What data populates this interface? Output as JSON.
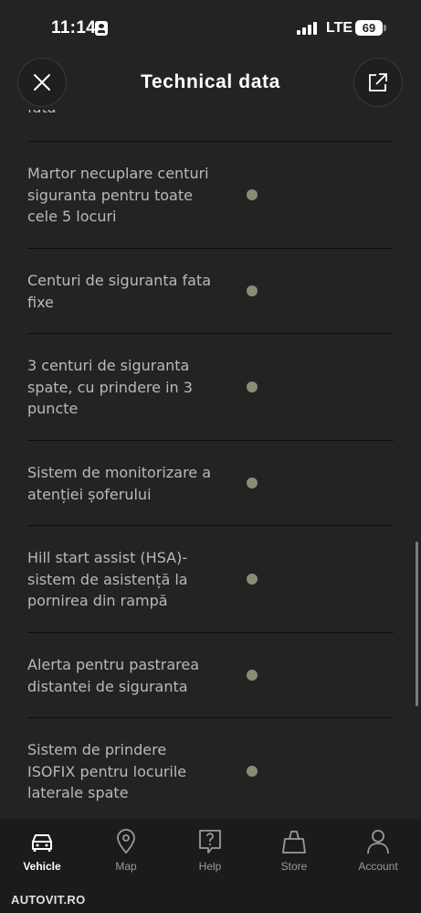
{
  "status_bar": {
    "time": "11:14",
    "network": "LTE",
    "battery": "69"
  },
  "header": {
    "title": "Technical data"
  },
  "features": [
    {
      "label": "fata",
      "available": true
    },
    {
      "label": "Martor necuplare centuri siguranta pentru toate cele 5 locuri",
      "available": true
    },
    {
      "label": "Centuri de siguranta fata fixe",
      "available": true
    },
    {
      "label": "3 centuri de siguranta spate, cu prindere in 3 puncte",
      "available": true
    },
    {
      "label": "Sistem de monitorizare a atenției șoferului",
      "available": true
    },
    {
      "label": "Hill start assist (HSA)-sistem de asistență la pornirea din rampă",
      "available": true
    },
    {
      "label": "Alerta pentru pastrarea distantei de siguranta",
      "available": true
    },
    {
      "label": "Sistem de prindere ISOFIX pentru locurile laterale spate",
      "available": true
    }
  ],
  "colors": {
    "background": "#232323",
    "feature_dot": "#8c8c73",
    "text": "#b9b9b9"
  },
  "tabs": [
    {
      "label": "Vehicle",
      "icon": "car-icon",
      "active": true
    },
    {
      "label": "Map",
      "icon": "map-pin-icon",
      "active": false
    },
    {
      "label": "Help",
      "icon": "help-icon",
      "active": false
    },
    {
      "label": "Store",
      "icon": "shopping-bag-icon",
      "active": false
    },
    {
      "label": "Account",
      "icon": "user-icon",
      "active": false
    }
  ],
  "brand": "AUTOVIT.RO"
}
